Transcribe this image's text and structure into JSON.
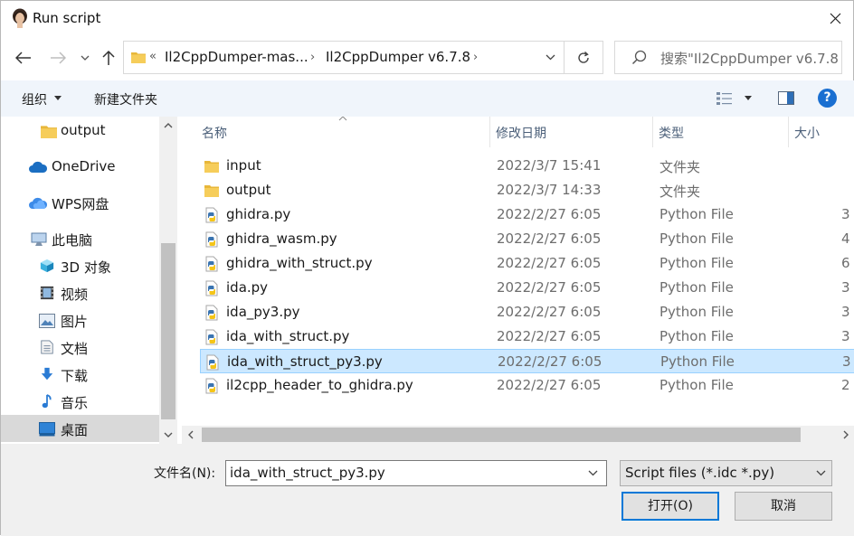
{
  "window": {
    "title": "Run script"
  },
  "address": {
    "overflow": "«",
    "crumbs": [
      "Il2CppDumper-mas...",
      "Il2CppDumper v6.7.8"
    ],
    "separator": "›"
  },
  "search": {
    "placeholder": "搜索\"Il2CppDumper v6.7.8\""
  },
  "toolbar": {
    "organize_label": "组织",
    "new_folder_label": "新建文件夹",
    "help_label": "?"
  },
  "sidebar": {
    "items": [
      {
        "label": "output",
        "icon": "folder-icon"
      },
      {
        "label": "OneDrive",
        "icon": "cloud-icon"
      },
      {
        "label": "WPS网盘",
        "icon": "cloud-icon"
      },
      {
        "label": "此电脑",
        "icon": "computer-icon"
      },
      {
        "label": "3D 对象",
        "icon": "3d-objects-icon"
      },
      {
        "label": "视频",
        "icon": "video-icon"
      },
      {
        "label": "图片",
        "icon": "pictures-icon"
      },
      {
        "label": "文档",
        "icon": "documents-icon"
      },
      {
        "label": "下载",
        "icon": "download-icon"
      },
      {
        "label": "音乐",
        "icon": "music-icon"
      },
      {
        "label": "桌面",
        "icon": "desktop-icon",
        "selected": true
      }
    ]
  },
  "columns": {
    "name": "名称",
    "date": "修改日期",
    "type": "类型",
    "size": "大小"
  },
  "files": [
    {
      "name": "input",
      "date": "2022/3/7 15:41",
      "type": "文件夹",
      "size": "",
      "kind": "folder"
    },
    {
      "name": "output",
      "date": "2022/3/7 14:33",
      "type": "文件夹",
      "size": "",
      "kind": "folder"
    },
    {
      "name": "ghidra.py",
      "date": "2022/2/27 6:05",
      "type": "Python File",
      "size": "3",
      "kind": "python"
    },
    {
      "name": "ghidra_wasm.py",
      "date": "2022/2/27 6:05",
      "type": "Python File",
      "size": "4",
      "kind": "python"
    },
    {
      "name": "ghidra_with_struct.py",
      "date": "2022/2/27 6:05",
      "type": "Python File",
      "size": "6",
      "kind": "python"
    },
    {
      "name": "ida.py",
      "date": "2022/2/27 6:05",
      "type": "Python File",
      "size": "3",
      "kind": "python"
    },
    {
      "name": "ida_py3.py",
      "date": "2022/2/27 6:05",
      "type": "Python File",
      "size": "3",
      "kind": "python"
    },
    {
      "name": "ida_with_struct.py",
      "date": "2022/2/27 6:05",
      "type": "Python File",
      "size": "3",
      "kind": "python"
    },
    {
      "name": "ida_with_struct_py3.py",
      "date": "2022/2/27 6:05",
      "type": "Python File",
      "size": "3",
      "kind": "python",
      "selected": true
    },
    {
      "name": "il2cpp_header_to_ghidra.py",
      "date": "2022/2/27 6:05",
      "type": "Python File",
      "size": "2",
      "kind": "python"
    }
  ],
  "footer": {
    "filename_label": "文件名(N):",
    "filename_value": "ida_with_struct_py3.py",
    "filter_value": "Script files (*.idc *.py)",
    "open_label": "打开(O)",
    "cancel_label": "取消"
  },
  "colors": {
    "accent": "#0078d7",
    "selected_row": "#cce8ff",
    "toolbar_bg": "#f0f5fb",
    "folder": "#e8b73a"
  }
}
